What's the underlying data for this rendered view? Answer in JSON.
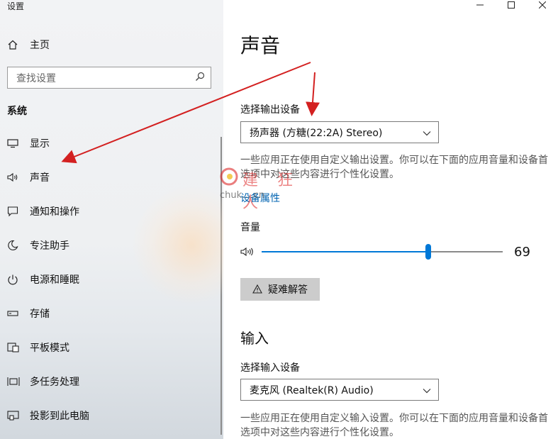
{
  "window": {
    "title": "设置"
  },
  "sidebar": {
    "home_label": "主页",
    "search_placeholder": "查找设置",
    "section_title": "系统",
    "items": [
      {
        "label": "显示",
        "icon": "monitor-icon"
      },
      {
        "label": "声音",
        "icon": "speaker-icon"
      },
      {
        "label": "通知和操作",
        "icon": "notification-icon"
      },
      {
        "label": "专注助手",
        "icon": "moon-icon"
      },
      {
        "label": "电源和睡眠",
        "icon": "power-icon"
      },
      {
        "label": "存储",
        "icon": "storage-icon"
      },
      {
        "label": "平板模式",
        "icon": "tablet-icon"
      },
      {
        "label": "多任务处理",
        "icon": "multitask-icon"
      },
      {
        "label": "投影到此电脑",
        "icon": "project-icon"
      }
    ]
  },
  "main": {
    "title": "声音",
    "output": {
      "label": "选择输出设备",
      "device": "扬声器 (方糖(22:2A) Stereo)",
      "description": "一些应用正在使用自定义输出设置。你可以在下面的应用音量和设备首选项中对这些内容进行个性化设置。",
      "properties_link": "设备属性",
      "volume_label": "音量",
      "volume_value": "69",
      "volume_level": 0.69,
      "troubleshoot_label": "疑难解答"
    },
    "input": {
      "heading": "输入",
      "label": "选择输入设备",
      "device": "麦克风 (Realtek(R) Audio)",
      "description": "一些应用正在使用自定义输入设置。你可以在下面的应用音量和设备首选项中对这些内容进行个性化设置。"
    }
  },
  "watermark": {
    "text": "建 狂 人",
    "url": "chuk....cn"
  },
  "colors": {
    "accent": "#0078d7",
    "link": "#0063b1",
    "annotation": "#d32020"
  }
}
